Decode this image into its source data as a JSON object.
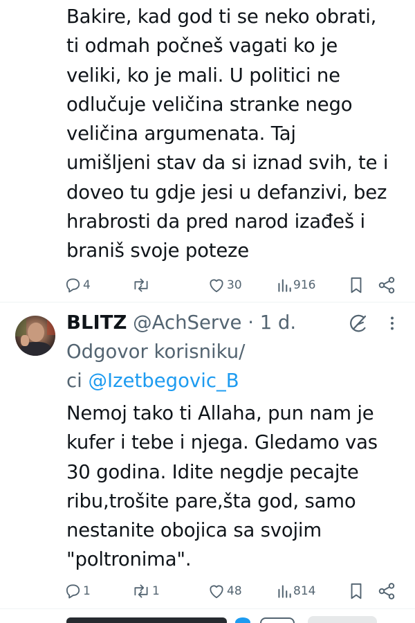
{
  "tweet1": {
    "text": "Bakire, kad god ti se neko obrati,\nti odmah počneš vagati ko je\nveliki, ko je mali. U politici ne\nodlučuje veličina stranke nego\nveličina argumenata. Taj\numišljeni stav da si iznad svih, te i\ndoveo tu gdje jesi u defanzivi, bez\nhrabrosti da pred narod izađeš i\nbraniš svoje poteze",
    "replies": "4",
    "retweets": "",
    "likes": "30",
    "views": "916"
  },
  "tweet2": {
    "name": "BLITZ",
    "handle": "@AchServe",
    "separator": "·",
    "time": "1 d.",
    "reply_prefix": "Odgovor korisniku/",
    "reply_prefix2": "ci",
    "reply_to": "@Izetbegovic_B",
    "text": "Nemoj tako ti Allaha, pun nam je\nkufer i tebe i njega. Gledamo vas\n30 godina. Idite negdje pecajte\nribu,trošite pare,šta god, samo\nnestanite obojica sa svojim\n\"poltronima\".",
    "replies": "1",
    "retweets": "1",
    "likes": "48",
    "views": "814"
  },
  "icons": {
    "reply": "reply-icon",
    "retweet": "retweet-icon",
    "like": "heart-icon",
    "views": "views-icon",
    "bookmark": "bookmark-icon",
    "share": "share-icon",
    "grok": "grok-icon",
    "more": "more-icon"
  },
  "colors": {
    "text": "#0f1419",
    "secondary": "#536471",
    "link": "#1d9bf0",
    "divider": "#eff3f4"
  }
}
